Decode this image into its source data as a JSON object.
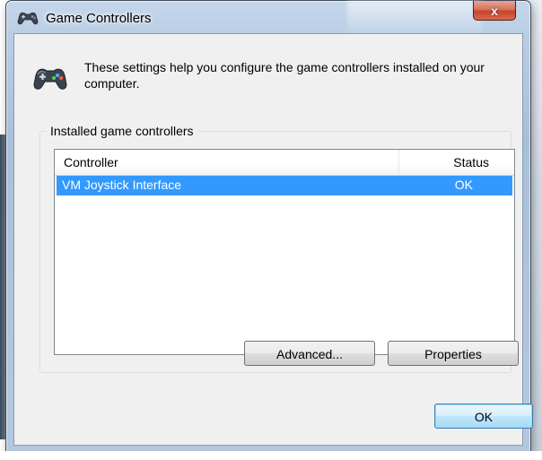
{
  "window": {
    "title": "Game Controllers",
    "close_label": "x"
  },
  "header": {
    "text": "These settings help you configure the game controllers installed on your computer."
  },
  "group": {
    "legend": "Installed game controllers"
  },
  "listview": {
    "columns": [
      "Controller",
      "Status"
    ],
    "rows": [
      {
        "controller": "VM Joystick Interface",
        "status": "OK",
        "selected": true
      }
    ]
  },
  "buttons": {
    "advanced": "Advanced...",
    "properties": "Properties",
    "ok": "OK"
  },
  "icons": {
    "app": "gamepad-icon",
    "header": "gamepad-icon",
    "close": "close-icon"
  },
  "colors": {
    "selection": "#3399ff",
    "close_button": "#c7432a",
    "default_button_border": "#3c7fb1"
  }
}
